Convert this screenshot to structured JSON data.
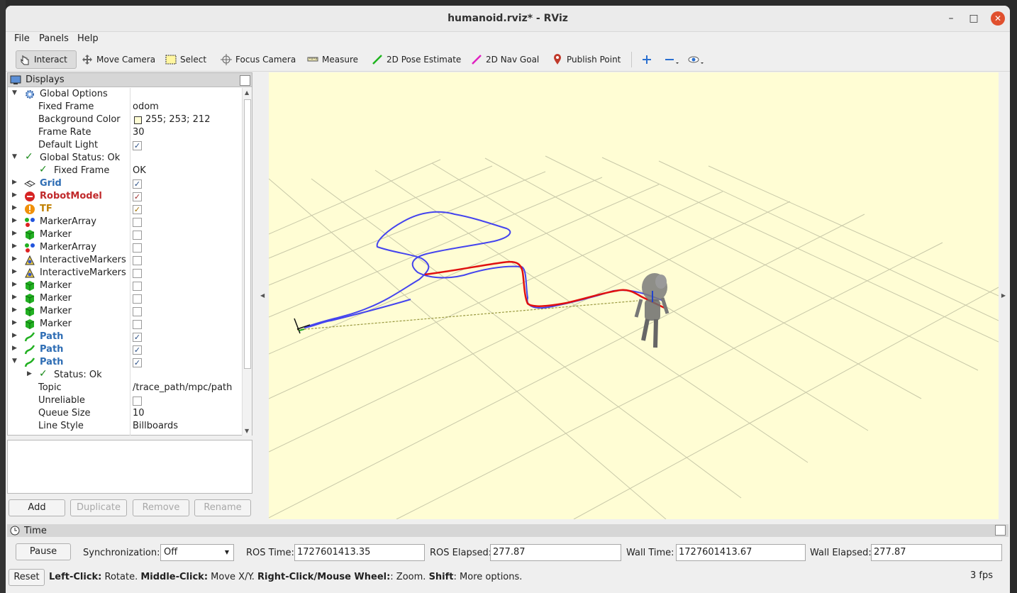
{
  "window": {
    "title": "humanoid.rviz* - RViz"
  },
  "menu": [
    "File",
    "Panels",
    "Help"
  ],
  "toolbar": {
    "tools": [
      "Interact",
      "Move Camera",
      "Select",
      "Focus Camera",
      "Measure",
      "2D Pose Estimate",
      "2D Nav Goal",
      "Publish Point"
    ],
    "active": "Interact",
    "icons": [
      "hand-pointer-icon",
      "move-camera-icon",
      "select-icon",
      "focus-camera-icon",
      "measure-icon",
      "pose-estimate-icon",
      "nav-goal-icon",
      "publish-point-icon",
      "plus-icon",
      "minus-icon",
      "eye-icon"
    ]
  },
  "displays": {
    "title": "Displays",
    "global_options": {
      "label": "Global Options",
      "fixed_frame_label": "Fixed Frame",
      "fixed_frame": "odom",
      "background_color_label": "Background Color",
      "background_color": "255; 253; 212",
      "frame_rate_label": "Frame Rate",
      "frame_rate": "30",
      "default_light_label": "Default Light",
      "default_light": true
    },
    "global_status": {
      "label": "Global Status: Ok",
      "fixed_frame_label": "Fixed Frame",
      "fixed_frame_value": "OK"
    },
    "items": [
      {
        "name": "Grid",
        "checked": true,
        "style": "blue"
      },
      {
        "name": "RobotModel",
        "checked": true,
        "style": "red"
      },
      {
        "name": "TF",
        "checked": true,
        "style": "orange"
      },
      {
        "name": "MarkerArray",
        "checked": false,
        "style": "plain"
      },
      {
        "name": "Marker",
        "checked": false,
        "style": "plain"
      },
      {
        "name": "MarkerArray",
        "checked": false,
        "style": "plain"
      },
      {
        "name": "InteractiveMarkers",
        "checked": false,
        "style": "plain"
      },
      {
        "name": "InteractiveMarkers",
        "checked": false,
        "style": "plain"
      },
      {
        "name": "Marker",
        "checked": false,
        "style": "plain"
      },
      {
        "name": "Marker",
        "checked": false,
        "style": "plain"
      },
      {
        "name": "Marker",
        "checked": false,
        "style": "plain"
      },
      {
        "name": "Marker",
        "checked": false,
        "style": "plain"
      },
      {
        "name": "Path",
        "checked": true,
        "style": "blue"
      },
      {
        "name": "Path",
        "checked": true,
        "style": "blue"
      },
      {
        "name": "Path",
        "checked": true,
        "style": "blue"
      }
    ],
    "path_details": {
      "status": "Status: Ok",
      "topic_label": "Topic",
      "topic": "/trace_path/mpc/path",
      "unreliable_label": "Unreliable",
      "unreliable": false,
      "queue_size_label": "Queue Size",
      "queue_size": "10",
      "line_style_label": "Line Style",
      "line_style": "Billboards"
    },
    "buttons": {
      "add": "Add",
      "duplicate": "Duplicate",
      "remove": "Remove",
      "rename": "Rename"
    }
  },
  "time": {
    "title": "Time",
    "pause": "Pause",
    "sync_label": "Synchronization:",
    "sync_value": "Off",
    "ros_time_label": "ROS Time:",
    "ros_time": "1727601413.35",
    "ros_elapsed_label": "ROS Elapsed:",
    "ros_elapsed": "277.87",
    "wall_time_label": "Wall Time:",
    "wall_time": "1727601413.67",
    "wall_elapsed_label": "Wall Elapsed:",
    "wall_elapsed": "277.87"
  },
  "status": {
    "reset": "Reset",
    "b1": "Left-Click:",
    "t1": " Rotate. ",
    "b2": "Middle-Click:",
    "t2": " Move X/Y. ",
    "b3": "Right-Click/Mouse Wheel:",
    "t3": ": Zoom. ",
    "b4": "Shift",
    "t4": ": More options.",
    "fps": "3 fps"
  },
  "colors": {
    "viewport_bg": "#fffdd4",
    "path_blue": "#4444ee",
    "path_red": "#e01010"
  }
}
